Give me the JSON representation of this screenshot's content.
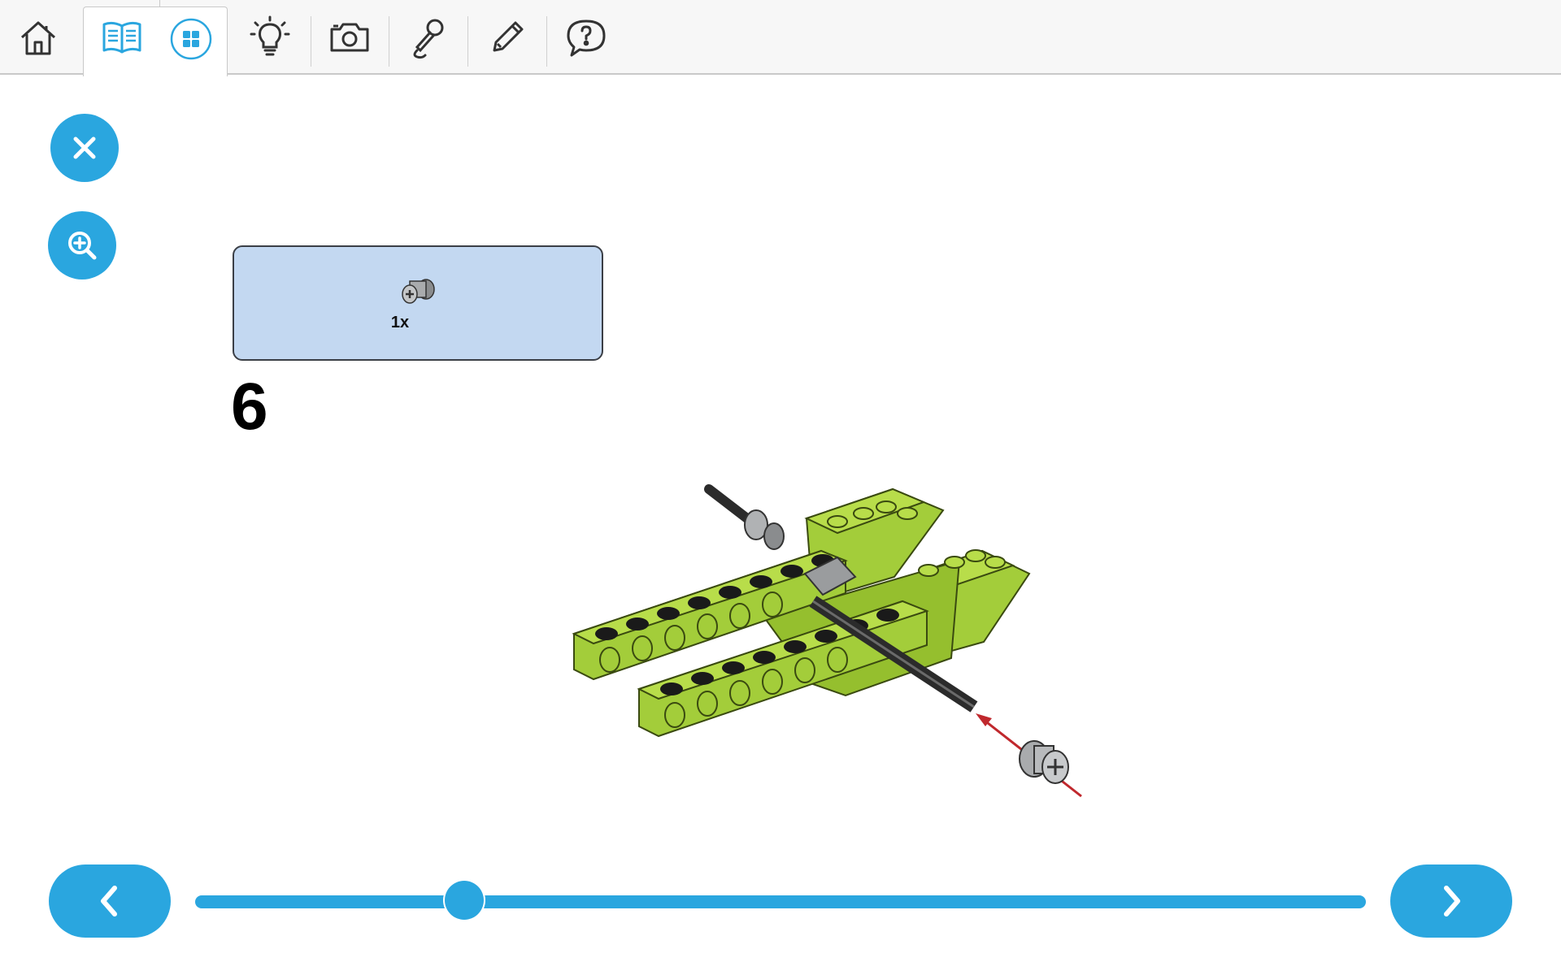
{
  "toolbar": {
    "items": [
      {
        "icon": "home-icon"
      },
      {
        "icon": "book-icon",
        "active": true
      },
      {
        "icon": "grid-icon"
      },
      {
        "icon": "lightbulb-icon"
      },
      {
        "icon": "camera-icon"
      },
      {
        "icon": "microphone-icon"
      },
      {
        "icon": "pencil-icon"
      },
      {
        "icon": "help-icon"
      }
    ],
    "accent_color": "#2aa6df"
  },
  "side_buttons": {
    "close": {
      "icon": "close-icon"
    },
    "zoom": {
      "icon": "zoom-in-icon"
    }
  },
  "parts_box": {
    "part_icon": "bushing-part-icon",
    "quantity": "1x",
    "background": "#c3d8f1"
  },
  "step": {
    "number": "6"
  },
  "navigation": {
    "prev": {
      "icon": "chevron-left-icon"
    },
    "next": {
      "icon": "chevron-right-icon"
    },
    "progress": 0.23
  }
}
